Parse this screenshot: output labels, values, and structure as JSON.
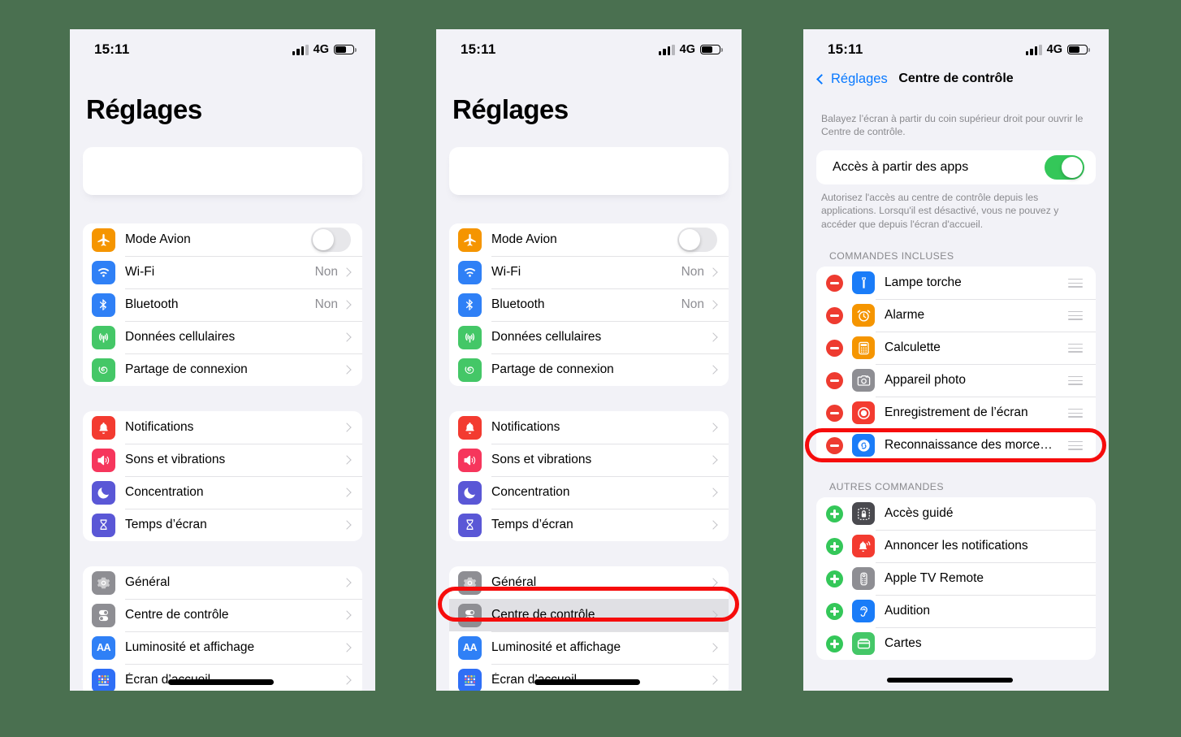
{
  "background_color": "#4a7050",
  "accent_blue": "#0a7aff",
  "highlight_color": "#f60c0c",
  "status_bar": {
    "time": "15:11",
    "network": "4G"
  },
  "phone1": {
    "title": "Réglages",
    "search_placeholder": "",
    "groups": [
      {
        "rows": [
          {
            "label": "Mode Avion",
            "icon": "airplane-icon",
            "icon_color": "#f59500",
            "control": "toggle",
            "toggle_on": false
          },
          {
            "label": "Wi-Fi",
            "icon": "wifi-icon",
            "icon_color": "#2f80f6",
            "control": "value",
            "value": "Non"
          },
          {
            "label": "Bluetooth",
            "icon": "bluetooth-icon",
            "icon_color": "#2f80f6",
            "control": "value",
            "value": "Non"
          },
          {
            "label": "Données cellulaires",
            "icon": "cellular-antenna-icon",
            "icon_color": "#44c767",
            "control": "chevron",
            "value": ""
          },
          {
            "label": "Partage de connexion",
            "icon": "hotspot-icon",
            "icon_color": "#44c767",
            "control": "chevron",
            "value": ""
          }
        ]
      },
      {
        "rows": [
          {
            "label": "Notifications",
            "icon": "bell-icon",
            "icon_color": "#f33b30",
            "control": "chevron",
            "value": ""
          },
          {
            "label": "Sons et vibrations",
            "icon": "speaker-icon",
            "icon_color": "#f6365c",
            "control": "chevron",
            "value": ""
          },
          {
            "label": "Concentration",
            "icon": "moon-icon",
            "icon_color": "#5a57d6",
            "control": "chevron",
            "value": ""
          },
          {
            "label": "Temps d’écran",
            "icon": "hourglass-icon",
            "icon_color": "#5a57d6",
            "control": "chevron",
            "value": ""
          }
        ]
      },
      {
        "rows": [
          {
            "label": "Général",
            "icon": "gear-icon",
            "icon_color": "#8e8e93",
            "control": "chevron",
            "value": ""
          },
          {
            "label": "Centre de contrôle",
            "icon": "control-center-icon",
            "icon_color": "#8e8e93",
            "control": "chevron",
            "value": ""
          },
          {
            "label": "Luminosité et affichage",
            "icon": "display-aa-icon",
            "icon_color": "#2f80f6",
            "control": "chevron",
            "value": ""
          },
          {
            "label": "Écran d’accueil",
            "icon": "home-screen-icon",
            "icon_color": "#2f6ff6",
            "control": "chevron",
            "value": ""
          }
        ]
      }
    ]
  },
  "phone2": {
    "title": "Réglages",
    "highlighted_row": "Centre de contrôle",
    "groups": [
      {
        "rows": [
          {
            "label": "Mode Avion",
            "icon": "airplane-icon",
            "icon_color": "#f59500",
            "control": "toggle",
            "toggle_on": false
          },
          {
            "label": "Wi-Fi",
            "icon": "wifi-icon",
            "icon_color": "#2f80f6",
            "control": "value",
            "value": "Non"
          },
          {
            "label": "Bluetooth",
            "icon": "bluetooth-icon",
            "icon_color": "#2f80f6",
            "control": "value",
            "value": "Non"
          },
          {
            "label": "Données cellulaires",
            "icon": "cellular-antenna-icon",
            "icon_color": "#44c767",
            "control": "chevron",
            "value": ""
          },
          {
            "label": "Partage de connexion",
            "icon": "hotspot-icon",
            "icon_color": "#44c767",
            "control": "chevron",
            "value": ""
          }
        ]
      },
      {
        "rows": [
          {
            "label": "Notifications",
            "icon": "bell-icon",
            "icon_color": "#f33b30",
            "control": "chevron",
            "value": ""
          },
          {
            "label": "Sons et vibrations",
            "icon": "speaker-icon",
            "icon_color": "#f6365c",
            "control": "chevron",
            "value": ""
          },
          {
            "label": "Concentration",
            "icon": "moon-icon",
            "icon_color": "#5a57d6",
            "control": "chevron",
            "value": ""
          },
          {
            "label": "Temps d’écran",
            "icon": "hourglass-icon",
            "icon_color": "#5a57d6",
            "control": "chevron",
            "value": ""
          }
        ]
      },
      {
        "rows": [
          {
            "label": "Général",
            "icon": "gear-icon",
            "icon_color": "#8e8e93",
            "control": "chevron",
            "value": ""
          },
          {
            "label": "Centre de contrôle",
            "icon": "control-center-icon",
            "icon_color": "#8e8e93",
            "control": "chevron",
            "value": "",
            "selected": true
          },
          {
            "label": "Luminosité et affichage",
            "icon": "display-aa-icon",
            "icon_color": "#2f80f6",
            "control": "chevron",
            "value": ""
          },
          {
            "label": "Écran d’accueil",
            "icon": "home-screen-icon",
            "icon_color": "#2f6ff6",
            "control": "chevron",
            "value": ""
          }
        ]
      }
    ]
  },
  "phone3": {
    "back_label": "Réglages",
    "nav_title": "Centre de contrôle",
    "intro_text": "Balayez l’écran à partir du coin supérieur droit pour ouvrir le Centre de contrôle.",
    "access_row": {
      "label": "Accès à partir des apps",
      "toggle_on": true
    },
    "access_footnote": "Autorisez l'accès au centre de contrôle depuis les applications. Lorsqu'il est désactivé, vous ne pouvez y accéder que depuis l'écran d'accueil.",
    "included_header": "COMMANDES INCLUSES",
    "included": [
      {
        "label": "Lampe torche",
        "icon": "flashlight-icon",
        "icon_color": "#1a7cf8",
        "action": "remove"
      },
      {
        "label": "Alarme",
        "icon": "alarm-clock-icon",
        "icon_color": "#f59500",
        "action": "remove"
      },
      {
        "label": "Calculette",
        "icon": "calculator-icon",
        "icon_color": "#f59500",
        "action": "remove"
      },
      {
        "label": "Appareil photo",
        "icon": "camera-icon",
        "icon_color": "#8e8e93",
        "action": "remove"
      },
      {
        "label": "Enregistrement de l’écran",
        "icon": "screen-record-icon",
        "icon_color": "#f33b30",
        "action": "remove",
        "highlighted": true
      },
      {
        "label": "Reconnaissance des morce…",
        "icon": "shazam-icon",
        "icon_color": "#1a7cf8",
        "action": "remove"
      }
    ],
    "others_header": "AUTRES COMMANDES",
    "others": [
      {
        "label": "Accès guidé",
        "icon": "guided-access-lock-icon",
        "icon_color": "#4a4a4f",
        "action": "add"
      },
      {
        "label": "Annoncer les notifications",
        "icon": "announce-notifications-icon",
        "icon_color": "#f33b30",
        "action": "add"
      },
      {
        "label": "Apple TV Remote",
        "icon": "tv-remote-icon",
        "icon_color": "#8e8e93",
        "action": "add"
      },
      {
        "label": "Audition",
        "icon": "hearing-ear-icon",
        "icon_color": "#1a7cf8",
        "action": "add"
      },
      {
        "label": "Cartes",
        "icon": "wallet-cards-icon",
        "icon_color": "#44c767",
        "action": "add"
      }
    ]
  }
}
